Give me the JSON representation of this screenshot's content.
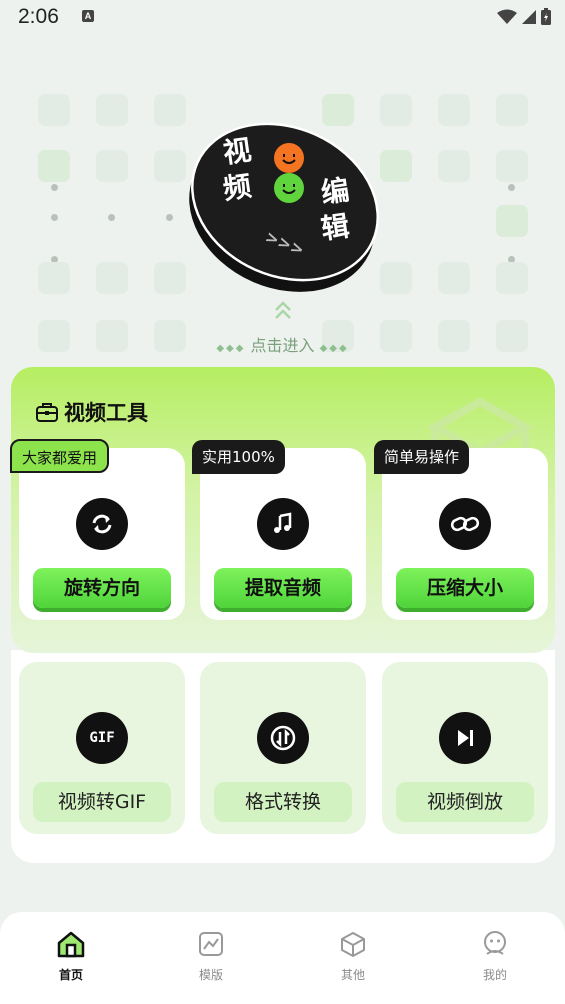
{
  "status_bar": {
    "time": "2:06",
    "notification_glyph": "A"
  },
  "hero": {
    "disc_text": [
      "视",
      "频",
      "编",
      "辑"
    ],
    "enter_hint": "点击进入"
  },
  "tools_section": {
    "title": "视频工具",
    "tools": [
      {
        "label": "旋转方向",
        "badge": "大家都爱用",
        "icon": "rotate-icon"
      },
      {
        "label": "提取音频",
        "badge": "实用100%",
        "icon": "music-note-icon"
      },
      {
        "label": "压缩大小",
        "badge": "简单易操作",
        "icon": "compress-link-icon"
      },
      {
        "label": "视频转GIF",
        "icon": "gif-icon"
      },
      {
        "label": "格式转换",
        "icon": "format-convert-icon"
      },
      {
        "label": "视频倒放",
        "icon": "reverse-play-icon"
      }
    ]
  },
  "bottom_nav": {
    "items": [
      {
        "label": "首页",
        "icon": "home-icon",
        "active": true
      },
      {
        "label": "模版",
        "icon": "template-chart-icon"
      },
      {
        "label": "其他",
        "icon": "cube-icon"
      },
      {
        "label": "我的",
        "icon": "profile-face-icon"
      }
    ]
  },
  "colors": {
    "accent_green": "#4fd43a",
    "badge_green": "#8de34c",
    "dark": "#111111",
    "background": "#eef2ef"
  }
}
